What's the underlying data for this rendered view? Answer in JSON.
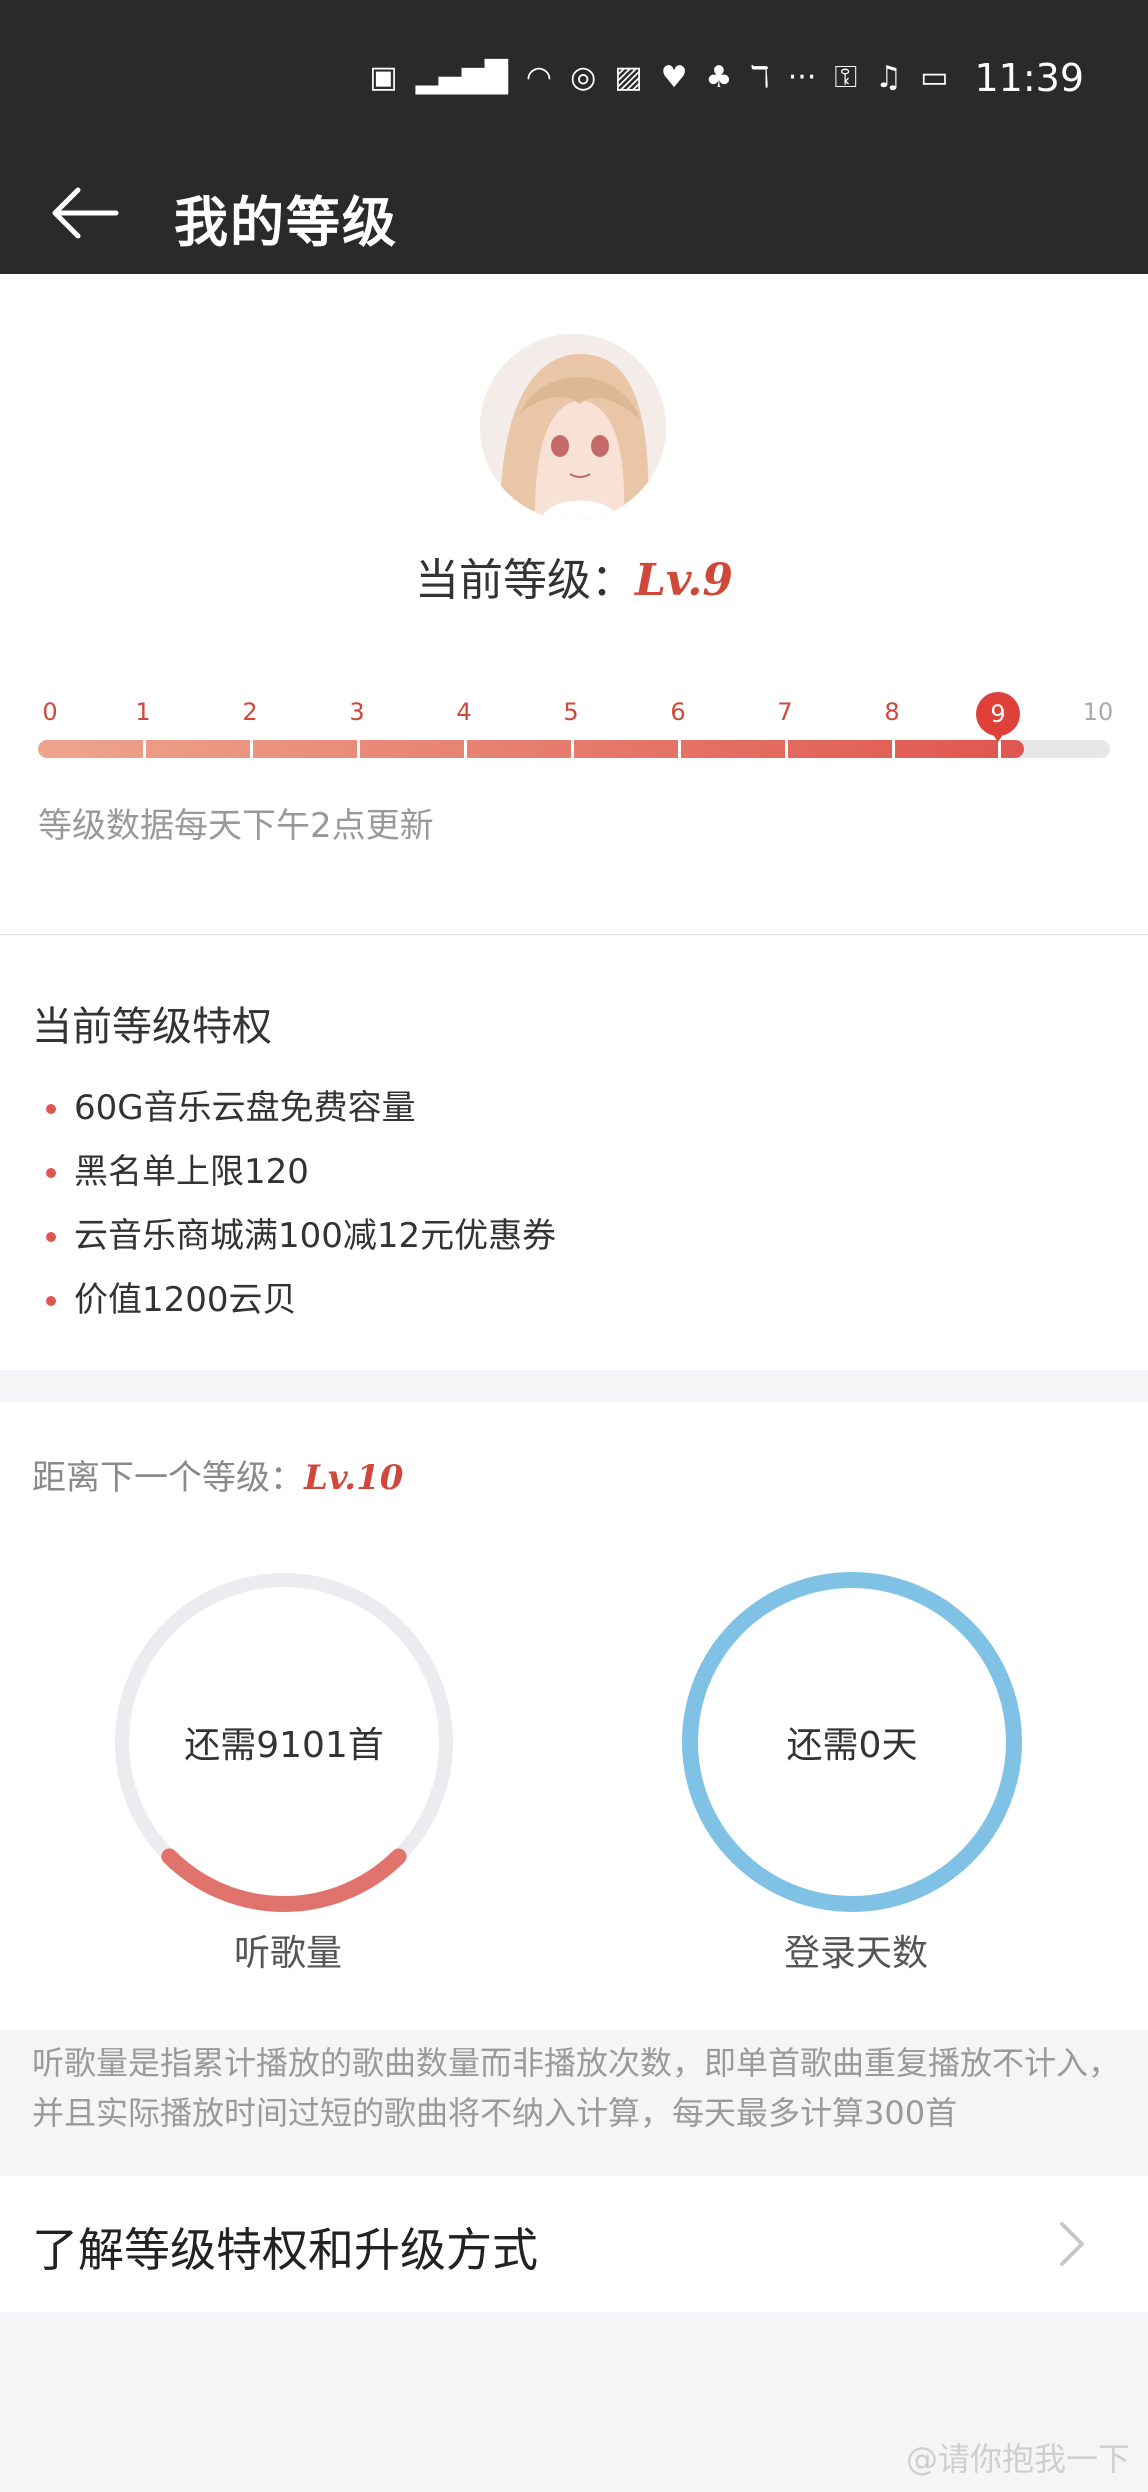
{
  "status_bar": {
    "icons": [
      "HD",
      "4G",
      "signal",
      "wifi",
      "location",
      "nfc",
      "heart",
      "qq",
      "translate",
      "more",
      "key",
      "mute-bell",
      "battery"
    ],
    "time": "11:39"
  },
  "app_bar": {
    "title": "我的等级"
  },
  "level": {
    "current_label": "当前等级：",
    "current_level": "Lv.9",
    "current_level_value": 9,
    "max_level": 10,
    "scale": [
      "0",
      "1",
      "2",
      "3",
      "4",
      "5",
      "6",
      "7",
      "8",
      "9",
      "10"
    ],
    "progress_fraction": 0.92,
    "update_note": "等级数据每天下午2点更新"
  },
  "privileges": {
    "title": "当前等级特权",
    "items": [
      "60G音乐云盘免费容量",
      "黑名单上限120",
      "云音乐商城满100减12元优惠券",
      "价值1200云贝"
    ]
  },
  "next_level": {
    "label": "距离下一个等级：",
    "level": "Lv.10",
    "songs": {
      "text": "还需9101首",
      "caption": "听歌量",
      "progress_fraction": 0.25,
      "color": "#e0736b"
    },
    "days": {
      "text": "还需0天",
      "caption": "登录天数",
      "progress_fraction": 1.0,
      "color": "#7fc2e6"
    }
  },
  "explanation": "听歌量是指累计播放的歌曲数量而非播放次数，即单首歌曲重复播放不计入，并且实际播放时间过短的歌曲将不纳入计算，每天最多计算300首",
  "learn_more": {
    "label": "了解等级特权和升级方式"
  },
  "watermark": "@请你抱我一下",
  "colors": {
    "accent": "#e0403a",
    "header_bg": "#2a2a2a",
    "ring_track": "#ebebf0"
  }
}
